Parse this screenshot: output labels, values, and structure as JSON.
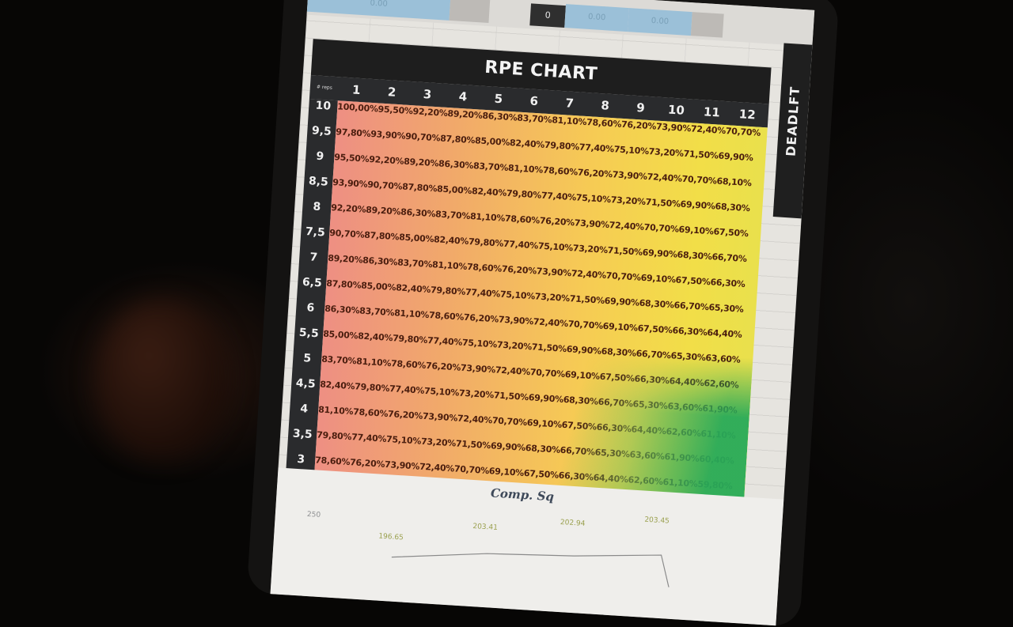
{
  "top_strip": {
    "values": [
      "0.00",
      "0.00",
      "0.00"
    ],
    "dark_cell": "0"
  },
  "rpe_chart": {
    "title": "RPE CHART",
    "corner_label": "# reps",
    "columns": [
      "1",
      "2",
      "3",
      "4",
      "5",
      "6",
      "7",
      "8",
      "9",
      "10",
      "11",
      "12"
    ],
    "row_labels": [
      "10",
      "9,5",
      "9",
      "8,5",
      "8",
      "7,5",
      "7",
      "6,5",
      "6",
      "5,5",
      "5",
      "4,5",
      "4",
      "3,5",
      "3"
    ],
    "row_text": [
      "100,00%95,50%92,20%89,20%86,30%83,70%81,10%78,60%76,20%73,90%72,40%70,70%",
      "97,80%93,90%90,70%87,80%85,00%82,40%79,80%77,40%75,10%73,20%71,50%69,90%",
      "95,50%92,20%89,20%86,30%83,70%81,10%78,60%76,20%73,90%72,40%70,70%68,10%",
      "93,90%90,70%87,80%85,00%82,40%79,80%77,40%75,10%73,20%71,50%69,90%68,30%",
      "92,20%89,20%86,30%83,70%81,10%78,60%76,20%73,90%72,40%70,70%69,10%67,50%",
      "90,70%87,80%85,00%82,40%79,80%77,40%75,10%73,20%71,50%69,90%68,30%66,70%",
      "89,20%86,30%83,70%81,10%78,60%76,20%73,90%72,40%70,70%69,10%67,50%66,30%",
      "87,80%85,00%82,40%79,80%77,40%75,10%73,20%71,50%69,90%68,30%66,70%65,30%",
      "86,30%83,70%81,10%78,60%76,20%73,90%72,40%70,70%69,10%67,50%66,30%64,40%",
      "85,00%82,40%79,80%77,40%75,10%73,20%71,50%69,90%68,30%66,70%65,30%63,60%",
      "83,70%81,10%78,60%76,20%73,90%72,40%70,70%69,10%67,50%66,30%64,40%62,60%",
      "82,40%79,80%77,40%75,10%73,20%71,50%69,90%68,30%66,70%65,30%63,60%61,90%",
      "81,10%78,60%76,20%73,90%72,40%70,70%69,10%67,50%66,30%64,40%62,60%61,10%",
      "79,80%77,40%75,10%73,20%71,50%69,90%68,30%66,70%65,30%63,60%61,90%60,40%",
      "78,60%76,20%73,90%72,40%70,70%69,10%67,50%66,30%64,40%62,60%61,10%59,80%"
    ]
  },
  "side_tab": {
    "label": "DEADLFT"
  },
  "lower_chart": {
    "title": "Comp. Sq",
    "values": [
      "250",
      "196.65",
      "203.41",
      "202.94",
      "203.45"
    ]
  }
}
